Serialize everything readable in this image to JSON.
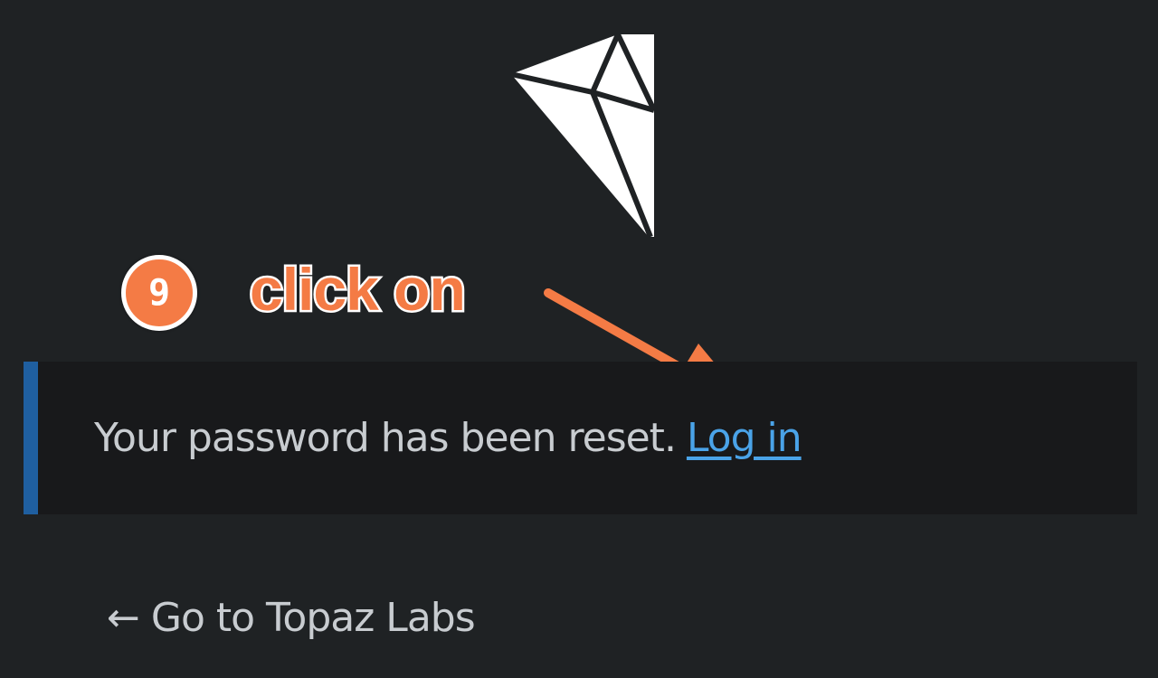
{
  "logo": {
    "icon": "kite-diamond-logo-icon",
    "color": "#ffffff"
  },
  "annotation": {
    "step_number": "9",
    "instruction": "click on",
    "accent_color": "#f47b45",
    "arrow_icon": "arrow-pointer-icon"
  },
  "notice": {
    "message": "Your password has been reset.",
    "link_label": "Log in",
    "border_color": "#1f5fa0",
    "link_color": "#4aa3e8"
  },
  "footer": {
    "back_link_label": "← Go to Topaz Labs"
  }
}
